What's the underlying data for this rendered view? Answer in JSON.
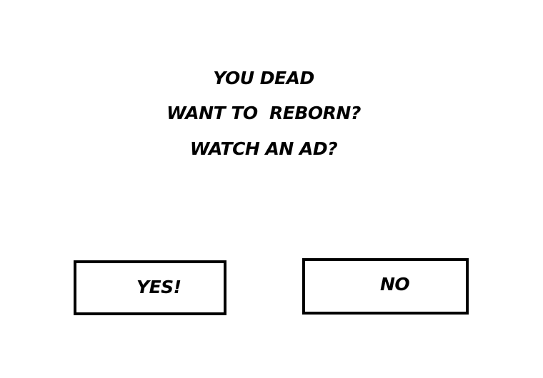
{
  "dialog": {
    "lines": [
      "YOU DEAD",
      "WANT TO  REBORN?",
      "WATCH AN AD?"
    ],
    "yes_label": "YES!",
    "no_label": "NO"
  },
  "colors": {
    "background": "#ffffff",
    "text": "#000000",
    "button_border": "#000000"
  }
}
